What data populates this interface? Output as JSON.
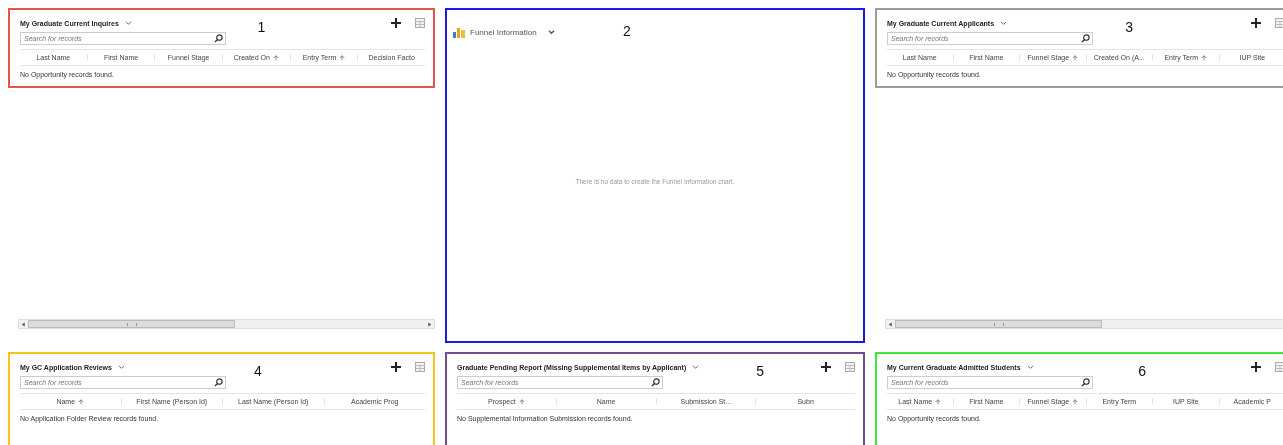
{
  "top_row": [
    {
      "kind": "list",
      "color": "#e8504a",
      "title": "My Graduate Current Inquires",
      "annotation": "1",
      "search": {
        "placeholder": "Search for records"
      },
      "columns": [
        {
          "label": "Last Name",
          "sorted": false
        },
        {
          "label": "First Name",
          "sorted": false
        },
        {
          "label": "Funnel Stage",
          "sorted": false
        },
        {
          "label": "Created On",
          "sorted": true
        },
        {
          "label": "Entry Term",
          "sorted": true
        },
        {
          "label": "Decision Facto",
          "sorted": false
        }
      ],
      "message": "No Opportunity records found."
    },
    {
      "kind": "chart",
      "color": "#1a1ae6",
      "title": "Funnel Information",
      "annotation": "2",
      "message": "There is no data to create the Funnel Information chart."
    },
    {
      "kind": "list",
      "color": "#9a9a9a",
      "title": "My Graduate Current Applicants",
      "annotation": "3",
      "search": {
        "placeholder": "Search for records"
      },
      "columns": [
        {
          "label": "Last Name",
          "sorted": false
        },
        {
          "label": "First Name",
          "sorted": false
        },
        {
          "label": "Funnel Stage",
          "sorted": true
        },
        {
          "label": "Created On (A...",
          "sorted": false
        },
        {
          "label": "Entry Term",
          "sorted": true
        },
        {
          "label": "IUP Site",
          "sorted": false
        }
      ],
      "message": "No Opportunity records found."
    }
  ],
  "bottom_row": [
    {
      "kind": "list",
      "color": "#f5c518",
      "title": "My GC Application Reviews",
      "annotation": "4",
      "search": {
        "placeholder": "Search for records"
      },
      "columns": [
        {
          "label": "Name",
          "sorted": true
        },
        {
          "label": "First Name (Person Id)",
          "sorted": false
        },
        {
          "label": "Last Name (Person Id)",
          "sorted": false
        },
        {
          "label": "Academic Prog",
          "sorted": false
        }
      ],
      "message": "No Application Folder Review records found."
    },
    {
      "kind": "list",
      "color": "#6b4f8e",
      "title": "Graduate Pending Report (Missing Supplemental Items by Applicant)",
      "annotation": "5",
      "search": {
        "placeholder": "Search for records"
      },
      "columns": [
        {
          "label": "Prospect",
          "sorted": true
        },
        {
          "label": "Name",
          "sorted": false
        },
        {
          "label": "Submission St...",
          "sorted": false
        },
        {
          "label": "Subn",
          "sorted": false
        }
      ],
      "message": "No Supplemental Information Submission records found."
    },
    {
      "kind": "list",
      "color": "#3ce63c",
      "title": "My Current Graduate Admitted Students",
      "annotation": "6",
      "search": {
        "placeholder": "Search for records"
      },
      "columns": [
        {
          "label": "Last Name",
          "sorted": true
        },
        {
          "label": "First Name",
          "sorted": false
        },
        {
          "label": "Funnel Stage",
          "sorted": true
        },
        {
          "label": "Entry Term",
          "sorted": false
        },
        {
          "label": "IUP Site",
          "sorted": false
        },
        {
          "label": "Academic P",
          "sorted": false
        }
      ],
      "message": "No Opportunity records found."
    }
  ]
}
